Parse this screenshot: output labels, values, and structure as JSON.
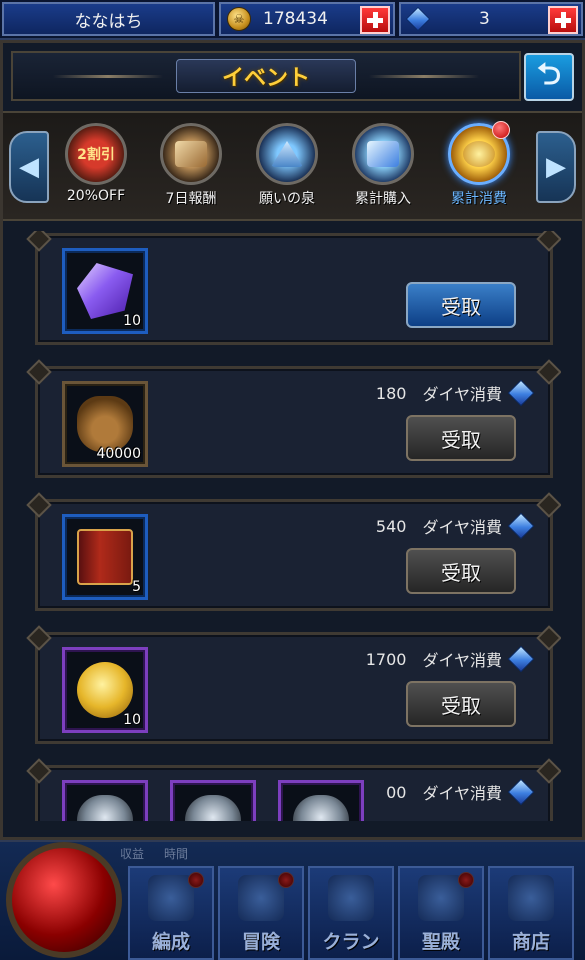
{
  "status": {
    "player_name": "ななはち",
    "gold": "178434",
    "gems": "3"
  },
  "header": {
    "title": "イベント"
  },
  "tabs": [
    {
      "label": "20%OFF",
      "icon_text": "2割引"
    },
    {
      "label": "7日報酬"
    },
    {
      "label": "願いの泉"
    },
    {
      "label": "累計購入"
    },
    {
      "label": "累計消費"
    }
  ],
  "rewards": [
    {
      "qty": "10",
      "cost": "",
      "cost_label": "",
      "button": "受取"
    },
    {
      "qty": "40000",
      "cost": "180",
      "cost_label": "ダイヤ消費",
      "button": "受取"
    },
    {
      "qty": "5",
      "cost": "540",
      "cost_label": "ダイヤ消費",
      "button": "受取"
    },
    {
      "qty": "10",
      "cost": "1700",
      "cost_label": "ダイヤ消費",
      "button": "受取"
    },
    {
      "qty": "",
      "cost": "00",
      "cost_label": "ダイヤ消費",
      "button": ""
    }
  ],
  "bottom": {
    "info_left": "収益",
    "info_right": "時間",
    "nav": [
      "編成",
      "冒険",
      "クラン",
      "聖殿",
      "商店"
    ]
  }
}
